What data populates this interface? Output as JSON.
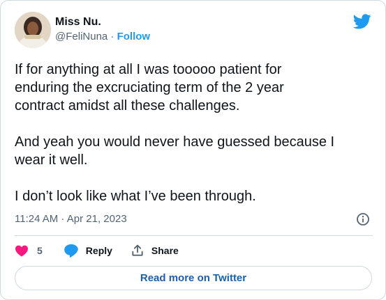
{
  "author": {
    "display_name": "Miss Nu.",
    "handle": "@FeliNuna",
    "separator": " · ",
    "follow_label": "Follow"
  },
  "tweet": {
    "text": "If for anything at all I was tooooo patient for\nenduring the excruciating term of the 2 year\ncontract amidst all these challenges.\n\nAnd yeah you would never have guessed because I\nwear it well.\n\nI don’t look like what I’ve been through.",
    "timestamp": "11:24 AM · Apr 21, 2023"
  },
  "actions": {
    "like_count": "5",
    "reply_label": "Reply",
    "share_label": "Share"
  },
  "read_more_label": "Read more on Twitter",
  "icons": {
    "logo": "twitter-bird-icon",
    "info": "info-icon",
    "like": "heart-icon",
    "reply": "speech-bubble-icon",
    "share": "share-upload-icon"
  },
  "colors": {
    "brand_blue": "#1d9bf0",
    "heart": "#f91880",
    "secondary_text": "#536471",
    "link": "#1d5fa8"
  }
}
